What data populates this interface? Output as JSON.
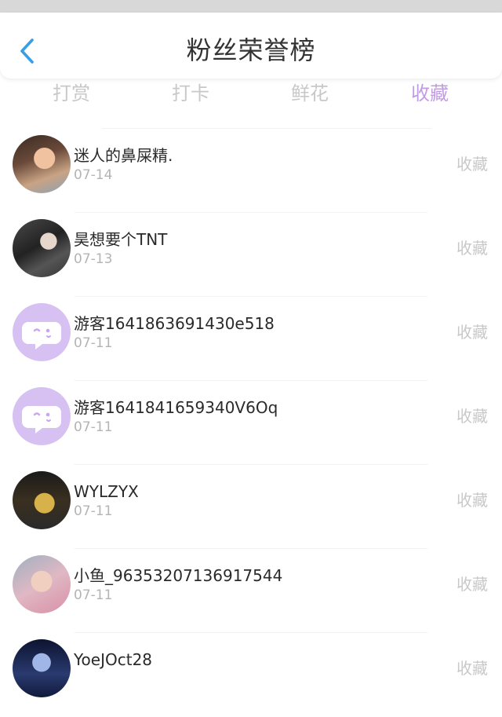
{
  "header": {
    "title": "粉丝荣誉榜",
    "back_icon": "chevron-left-icon",
    "accent_color": "#3a9ee6"
  },
  "tabs": [
    {
      "label": "打赏",
      "active": false
    },
    {
      "label": "打卡",
      "active": false
    },
    {
      "label": "鲜花",
      "active": false
    },
    {
      "label": "收藏",
      "active": true
    }
  ],
  "active_tab_color": "#c29be6",
  "list": [
    {
      "name": "迷人的鼻屎精.",
      "date": "07-14",
      "action": "收藏",
      "avatar": "photo-avatar"
    },
    {
      "name": "昊想要个TNT",
      "date": "07-13",
      "action": "收藏",
      "avatar": "photo-avatar"
    },
    {
      "name": "游客1641863691430e518",
      "date": "07-11",
      "action": "收藏",
      "avatar": "guest-chat-icon"
    },
    {
      "name": "游客1641841659340V6Oq",
      "date": "07-11",
      "action": "收藏",
      "avatar": "guest-chat-icon"
    },
    {
      "name": "WYLZYX",
      "date": "07-11",
      "action": "收藏",
      "avatar": "photo-avatar"
    },
    {
      "name": "小鱼_96353207136917544",
      "date": "07-11",
      "action": "收藏",
      "avatar": "photo-avatar"
    },
    {
      "name": "YoeJOct28",
      "date": "",
      "action": "收藏",
      "avatar": "photo-avatar"
    }
  ]
}
